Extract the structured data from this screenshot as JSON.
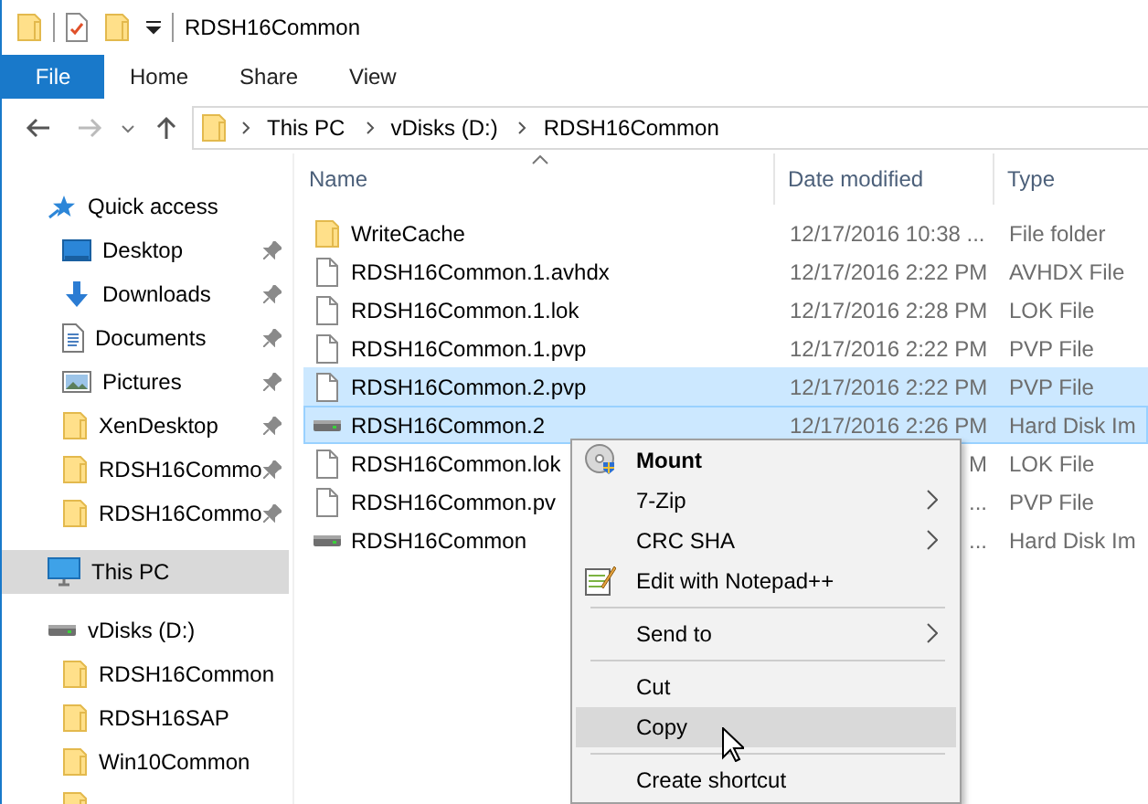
{
  "window": {
    "title": "RDSH16Common"
  },
  "ribbon_tabs": [
    {
      "label": "File",
      "kind": "file"
    },
    {
      "label": "Home",
      "kind": "tab"
    },
    {
      "label": "Share",
      "kind": "tab"
    },
    {
      "label": "View",
      "kind": "tab"
    }
  ],
  "address_bar": {
    "crumbs": [
      "This PC",
      "vDisks (D:)",
      "RDSH16Common"
    ]
  },
  "navigation_pane": {
    "items": [
      {
        "label": "Quick access",
        "kind": "star",
        "selected": false,
        "children": [
          {
            "label": "Desktop",
            "kind": "desktop",
            "pinned": true,
            "selected": false
          },
          {
            "label": "Downloads",
            "kind": "downloads",
            "pinned": true,
            "selected": false
          },
          {
            "label": "Documents",
            "kind": "documents",
            "pinned": true,
            "selected": false
          },
          {
            "label": "Pictures",
            "kind": "pictures",
            "pinned": true,
            "selected": false
          },
          {
            "label": "XenDesktop",
            "kind": "folder",
            "pinned": true,
            "selected": false
          },
          {
            "label": "RDSH16Commo",
            "kind": "folder",
            "pinned": true,
            "selected": false
          },
          {
            "label": "RDSH16Commo",
            "kind": "folder",
            "pinned": true,
            "selected": false
          }
        ]
      },
      {
        "label": "This PC",
        "kind": "pc",
        "selected": true
      },
      {
        "label": "vDisks (D:)",
        "kind": "drive",
        "selected": false,
        "children": [
          {
            "label": "RDSH16Common",
            "kind": "folder",
            "pinned": false,
            "selected": false
          },
          {
            "label": "RDSH16SAP",
            "kind": "folder",
            "pinned": false,
            "selected": false
          },
          {
            "label": "Win10Common",
            "kind": "folder",
            "pinned": false,
            "selected": false
          },
          {
            "kind": "folder",
            "pinned": false,
            "selected": false
          }
        ]
      }
    ]
  },
  "file_list": {
    "columns": [
      {
        "label": "Name",
        "sorted": true
      },
      {
        "label": "Date modified",
        "sorted": false
      },
      {
        "label": "Type",
        "sorted": false
      }
    ],
    "rows": [
      {
        "kind": "folder",
        "name": "WriteCache",
        "date": "12/17/2016 10:38 ...",
        "type": "File folder",
        "selected": false,
        "focused": false
      },
      {
        "kind": "file",
        "name": "RDSH16Common.1.avhdx",
        "date": "12/17/2016 2:22 PM",
        "type": "AVHDX File",
        "selected": false,
        "focused": false
      },
      {
        "kind": "file",
        "name": "RDSH16Common.1.lok",
        "date": "12/17/2016 2:28 PM",
        "type": "LOK File",
        "selected": false,
        "focused": false
      },
      {
        "kind": "file",
        "name": "RDSH16Common.1.pvp",
        "date": "12/17/2016 2:22 PM",
        "type": "PVP File",
        "selected": false,
        "focused": false
      },
      {
        "kind": "file",
        "name": "RDSH16Common.2.pvp",
        "date": "12/17/2016 2:22 PM",
        "type": "PVP File",
        "selected": true,
        "focused": false
      },
      {
        "kind": "disk",
        "name": "RDSH16Common.2",
        "date": "12/17/2016 2:26 PM",
        "type": "Hard Disk Im",
        "selected": true,
        "focused": true
      },
      {
        "kind": "file",
        "name": "RDSH16Common.lok",
        "date_tail": "M",
        "type": "LOK File",
        "selected": false,
        "focused": false
      },
      {
        "kind": "file",
        "name": "RDSH16Common.pv",
        "date_tail": "...",
        "type": "PVP File",
        "selected": false,
        "focused": false
      },
      {
        "kind": "disk",
        "name": "RDSH16Common",
        "date_tail": "...",
        "type": "Hard Disk Im",
        "selected": false,
        "focused": false
      }
    ]
  },
  "context_menu": {
    "items": [
      {
        "kind": "disc",
        "label": "Mount",
        "default": true,
        "submenu": false,
        "selected": false
      },
      {
        "kind": "plain",
        "label": "7-Zip",
        "default": false,
        "submenu": true,
        "selected": false
      },
      {
        "kind": "plain",
        "label": "CRC SHA",
        "default": false,
        "submenu": true,
        "selected": false
      },
      {
        "kind": "notepad",
        "label": "Edit with Notepad++",
        "default": false,
        "submenu": false,
        "selected": false
      },
      {
        "kind": "separator"
      },
      {
        "kind": "plain",
        "label": "Send to",
        "default": false,
        "submenu": true,
        "selected": false
      },
      {
        "kind": "separator"
      },
      {
        "kind": "plain",
        "label": "Cut",
        "default": false,
        "submenu": false,
        "selected": false
      },
      {
        "kind": "plain",
        "label": "Copy",
        "default": false,
        "submenu": false,
        "selected": true
      },
      {
        "kind": "separator"
      },
      {
        "kind": "plain",
        "label": "Create shortcut",
        "default": false,
        "submenu": false,
        "selected": false
      }
    ]
  }
}
